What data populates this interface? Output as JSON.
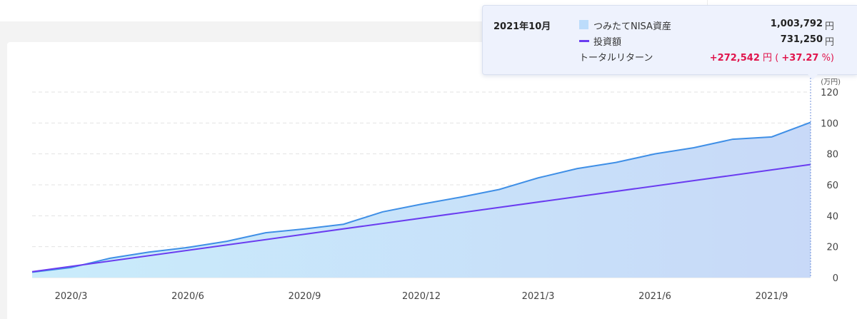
{
  "colors": {
    "area_fill_left": "#c9ecfb",
    "area_fill_right": "#c8d9f8",
    "asset_line": "#3f8fe6",
    "invest_line": "#6a3cf0",
    "grid": "#e3e3e3",
    "return_red": "#e0144c"
  },
  "chart_data": {
    "type": "area",
    "unit_label": "(万円)",
    "ylim": [
      0,
      120
    ],
    "y_ticks": [
      "0",
      "20",
      "40",
      "60",
      "80",
      "100",
      "120"
    ],
    "x_ticks": [
      "2020/3",
      "2020/6",
      "2020/9",
      "2020/12",
      "2021/3",
      "2021/6",
      "2021/9"
    ],
    "months": [
      "2020/2",
      "2020/3",
      "2020/4",
      "2020/5",
      "2020/6",
      "2020/7",
      "2020/8",
      "2020/9",
      "2020/10",
      "2020/11",
      "2020/12",
      "2021/1",
      "2021/2",
      "2021/3",
      "2021/4",
      "2021/5",
      "2021/6",
      "2021/7",
      "2021/8",
      "2021/9",
      "2021/10"
    ],
    "grid": true,
    "series": [
      {
        "name": "つみたてNISA資産",
        "type": "area",
        "values": [
          3.5,
          6.5,
          12.5,
          16.5,
          19.5,
          23.5,
          29,
          31.5,
          34.5,
          42.5,
          47.5,
          52,
          57,
          64.5,
          70.5,
          74.5,
          80,
          84,
          89.5,
          91,
          100.4
        ]
      },
      {
        "name": "投資額",
        "type": "line",
        "values": [
          3.8,
          7.9,
          12.5,
          16.5,
          20.5,
          24.5,
          28.6,
          32.5,
          36.5,
          40.6,
          44.6,
          48.7,
          52.7,
          56.8,
          60.8,
          64.9,
          68.9,
          73.1,
          77.1,
          73.13,
          73.13
        ]
      }
    ]
  },
  "tooltip": {
    "month": "2021年10月",
    "asset_label": "つみたてNISA資産",
    "asset_value": "1,003,792",
    "invest_label": "投資額",
    "invest_value": "731,250",
    "unit": "円",
    "return_label": "トータルリターン",
    "return_value": "+272,542",
    "return_pct_open": "( ",
    "return_pct": "+37.27",
    "return_pct_unit": "%)"
  }
}
